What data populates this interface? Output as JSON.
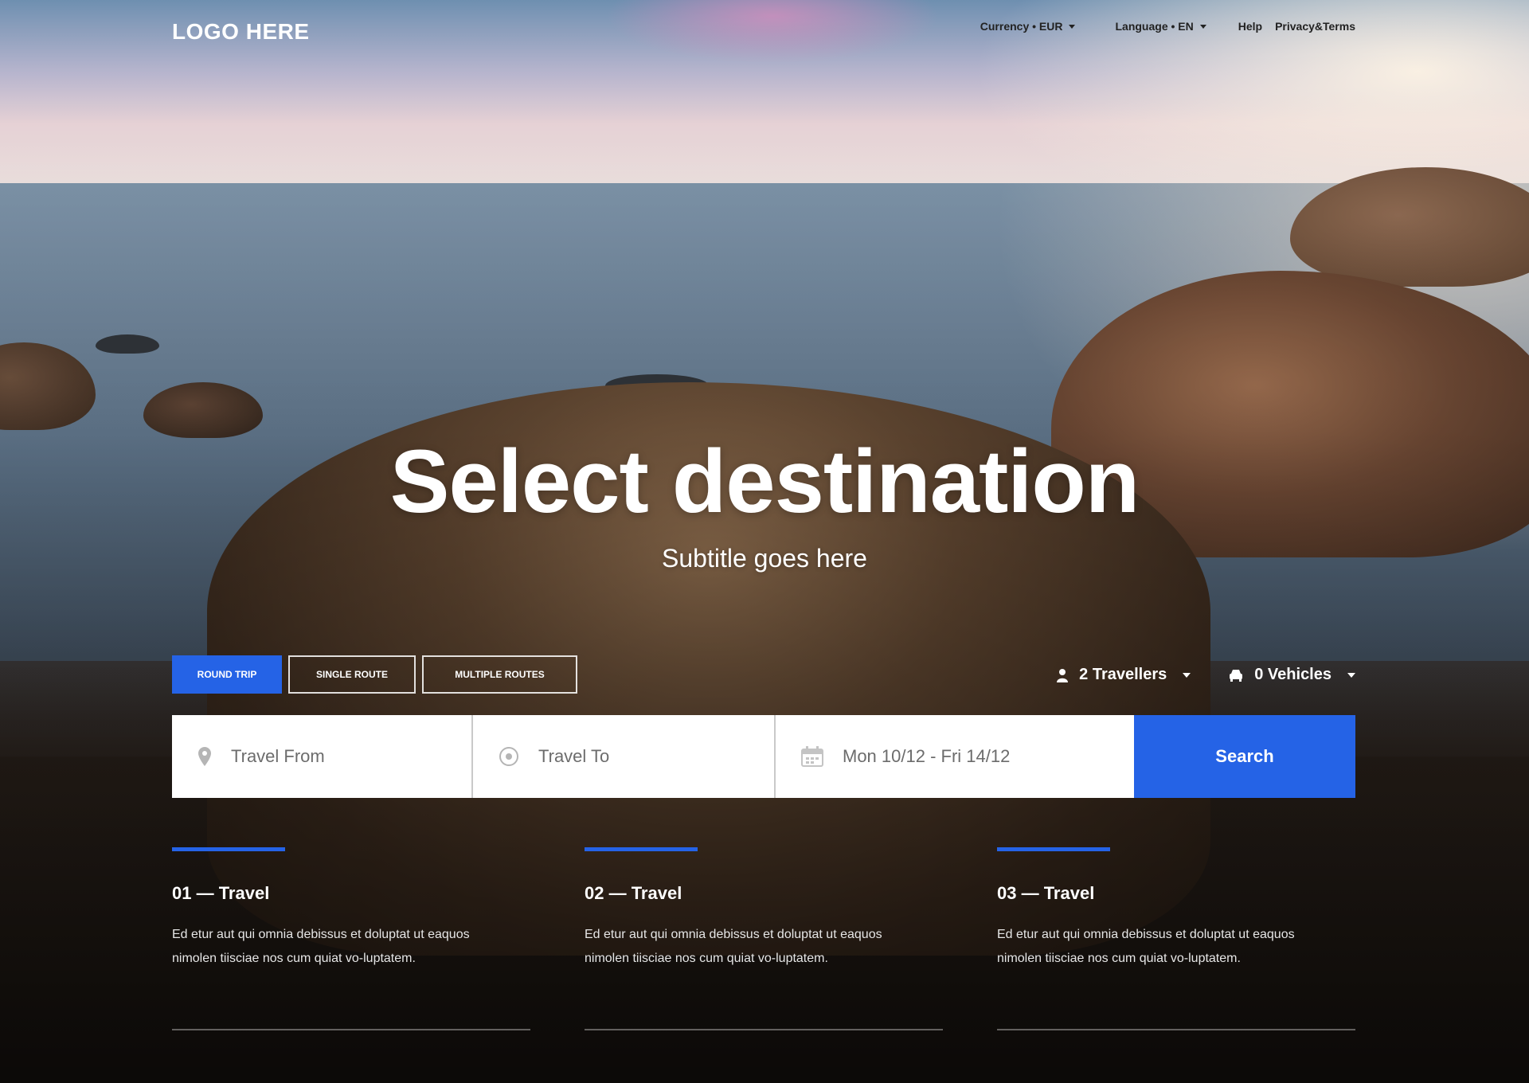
{
  "header": {
    "logo": "LOGO HERE",
    "nav": {
      "currency": "Currency • EUR",
      "language": "Language • EN",
      "help": "Help",
      "privacy": "Privacy&Terms"
    }
  },
  "hero": {
    "title": "Select destination",
    "subtitle": "Subtitle goes here"
  },
  "trip_types": {
    "round_trip": "ROUND TRIP",
    "single_route": "SINGLE ROUTE",
    "multiple_routes": "MULTIPLE ROUTES",
    "active": "ROUND TRIP"
  },
  "counters": {
    "travellers": "2 Travellers",
    "vehicles": "0 Vehicles"
  },
  "search": {
    "from_placeholder": "Travel From",
    "to_placeholder": "Travel To",
    "dates": "Mon 10/12 - Fri 14/12",
    "button": "Search"
  },
  "features": [
    {
      "title": "01 — Travel",
      "text": "Ed etur aut qui omnia debissus et doluptat ut eaquos nimolen tiisciae nos cum quiat vo-luptatem."
    },
    {
      "title": "02 — Travel",
      "text": "Ed etur aut qui omnia debissus et doluptat ut eaquos nimolen tiisciae nos cum quiat vo-luptatem."
    },
    {
      "title": "03 — Travel",
      "text": "Ed etur aut qui omnia debissus et doluptat ut eaquos nimolen tiisciae nos cum quiat vo-luptatem."
    }
  ],
  "colors": {
    "accent": "#2563e6",
    "text_light": "#ffffff",
    "text_dark": "#222222"
  },
  "icons": {
    "from": "map-pin-icon",
    "to": "target-icon",
    "dates": "calendar-icon",
    "travellers": "person-icon",
    "vehicles": "car-icon"
  }
}
